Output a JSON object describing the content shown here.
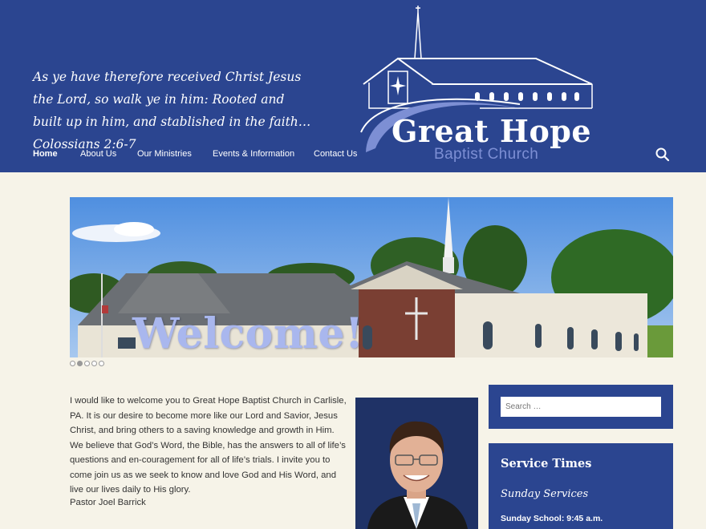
{
  "header": {
    "tagline": "As ye have therefore received Christ Jesus the Lord, so walk ye in him: Rooted and built up in him, and stablished in the faith… Colossians 2:6-7",
    "logo_title": "Great Hope",
    "logo_subtitle": "Baptist Church",
    "nav": [
      {
        "label": "Home",
        "active": true
      },
      {
        "label": "About Us",
        "active": false
      },
      {
        "label": "Our Ministries",
        "active": false
      },
      {
        "label": "Events & Information",
        "active": false
      },
      {
        "label": "Contact Us",
        "active": false
      }
    ],
    "search_icon": "search-icon"
  },
  "slider": {
    "caption": "Welcome!",
    "dots": 5,
    "active_dot": 2
  },
  "main": {
    "welcome_text": "I would like to welcome you to Great Hope Baptist Church in Carlisle, PA. It is our desire to become more like our Lord and Savior, Jesus Christ, and bring others to a saving knowledge and growth in Him. We believe that God’s Word, the Bible, has the answers to all of life’s questions and en-couragement for all of life’s trials. I invite you to come join us as we seek to know and love God and His Word, and live our lives daily to His glory.",
    "signature": "Pastor Joel Barrick"
  },
  "sidebar": {
    "search_placeholder": "Search …",
    "service_title": "Service Times",
    "service_subtitle": "Sunday Services",
    "service_line": "Sunday School: 9:45 a.m."
  },
  "colors": {
    "header_bg": "#2b4590",
    "page_bg": "#f6f3e8",
    "logo_accent": "#7d8fd4"
  }
}
